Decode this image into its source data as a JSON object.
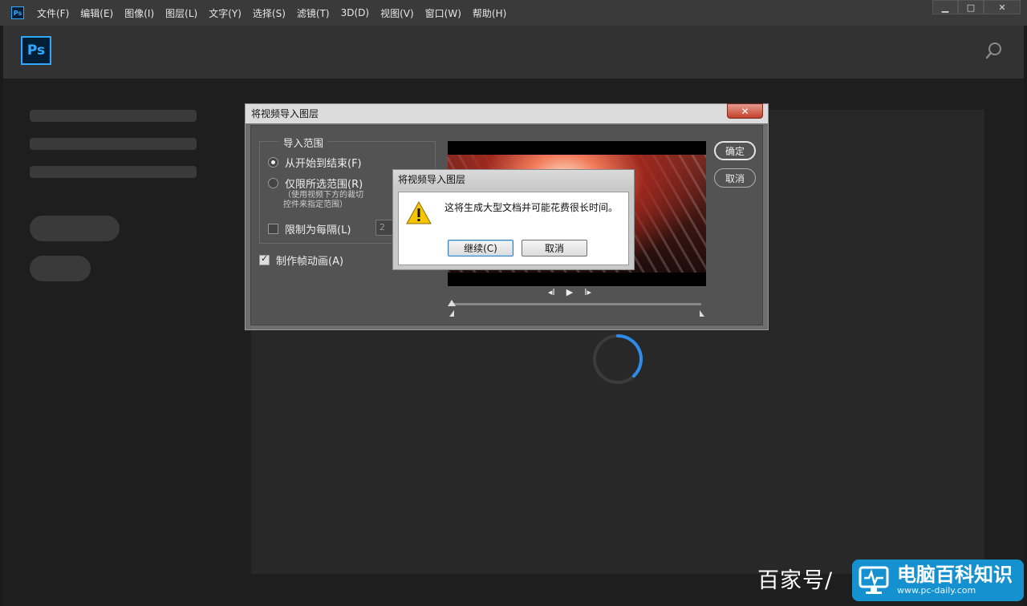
{
  "menubar": {
    "app_icon": "Ps",
    "items": [
      "文件(F)",
      "编辑(E)",
      "图像(I)",
      "图层(L)",
      "文字(Y)",
      "选择(S)",
      "滤镜(T)",
      "3D(D)",
      "视图(V)",
      "窗口(W)",
      "帮助(H)"
    ],
    "window_controls": [
      "▁",
      "□",
      "✕"
    ]
  },
  "header": {
    "logo": "Ps",
    "search_icon": "search-icon"
  },
  "import_dialog": {
    "title": "将视频导入图层",
    "close": "✕",
    "range_legend": "导入范围",
    "radio_all": "从开始到结束(F)",
    "radio_selected": "仅限所选范围(R)",
    "hint": "（使用视频下方的裁切\n控件来指定范围）",
    "limit_label": "限制为每隔(L)",
    "limit_value": "2",
    "make_animation": "制作帧动画(A)",
    "ok": "确定",
    "cancel": "取消",
    "transport": {
      "prev": "◂I",
      "play": "▶",
      "next": "I▸"
    }
  },
  "alert": {
    "title": "将视频导入图层",
    "message": "这将生成大型文档并可能花费很长时间。",
    "continue": "继续(C)",
    "cancel": "取消",
    "icon": "warning-icon"
  },
  "watermark": {
    "text": "百家号/",
    "brand": "电脑百科知识",
    "url": "www.pc-daily.com"
  },
  "colors": {
    "ps_blue": "#31a8ff",
    "spinner": "#2d8ceb",
    "watermark": "#1591cf"
  }
}
